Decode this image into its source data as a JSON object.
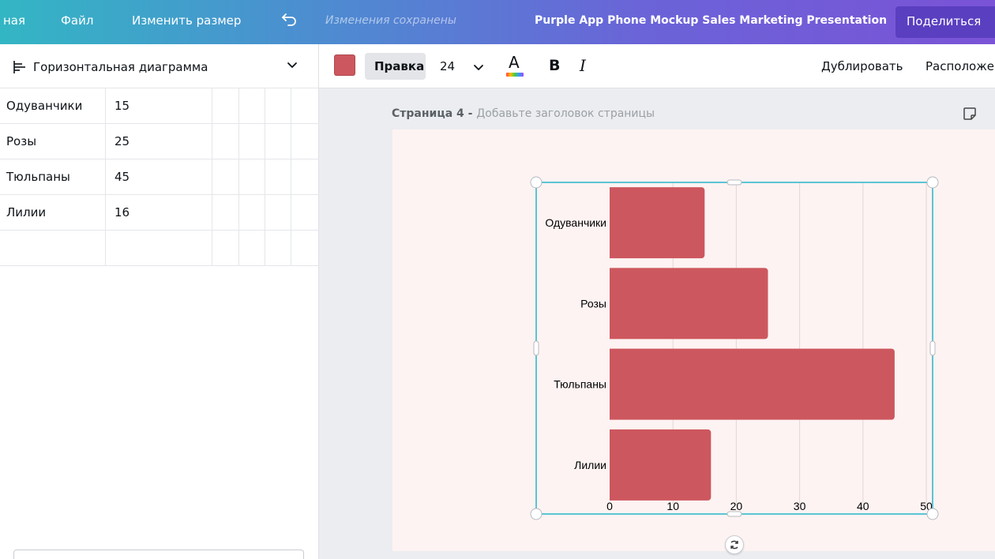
{
  "topbar": {
    "home_partial": "ная",
    "file": "Файл",
    "resize": "Изменить размер",
    "saved_status": "Изменения сохранены",
    "doc_title": "Purple App Phone Mockup Sales Marketing Presentation",
    "share": "Поделиться"
  },
  "left_panel": {
    "chart_type": "Горизонтальная диаграмма",
    "rows": [
      {
        "label": "Одуванчики",
        "value": "15"
      },
      {
        "label": "Розы",
        "value": "25"
      },
      {
        "label": "Тюльпаны",
        "value": "45"
      },
      {
        "label": "Лилии",
        "value": "16"
      },
      {
        "label": "",
        "value": ""
      }
    ]
  },
  "toolbar": {
    "color": "#cd575e",
    "edit": "Правка",
    "font_size": "24",
    "bold": "B",
    "italic": "I",
    "text_color_letter": "A",
    "duplicate": "Дублировать",
    "arrange": "Расположение"
  },
  "canvas": {
    "page_label": "Страница 4",
    "page_sep": " - ",
    "page_hint": "Добавьте заголовок страницы"
  },
  "chart_data": {
    "type": "bar",
    "orientation": "horizontal",
    "categories": [
      "Одуванчики",
      "Розы",
      "Тюльпаны",
      "Лилии"
    ],
    "values": [
      15,
      25,
      45,
      16
    ],
    "xlim": [
      0,
      50
    ],
    "xticks": [
      0,
      10,
      20,
      30,
      40,
      50
    ],
    "grid": true,
    "bar_color": "#cd575e"
  }
}
